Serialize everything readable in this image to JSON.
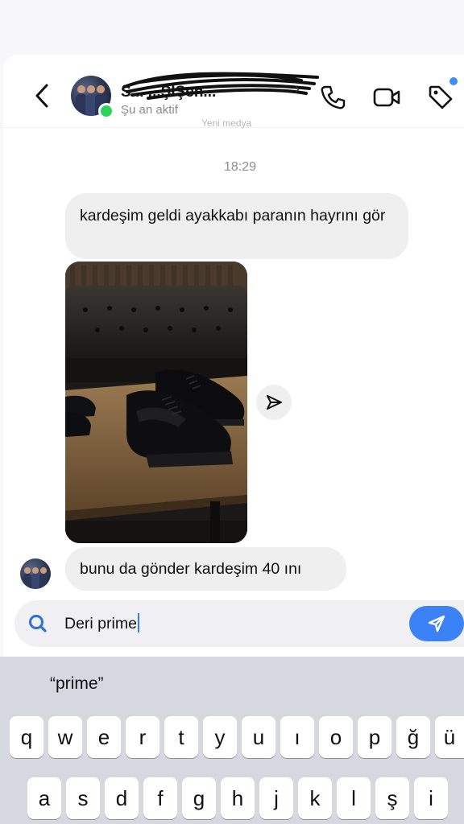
{
  "header": {
    "contact_name": "S... ...ŞİŞen...",
    "status": "Şu an aktif",
    "faded_text": "Yeni medya"
  },
  "messages": {
    "timestamp": "18:29",
    "message1": "kardeşim geldi ayakkabı paranın hayrını gör",
    "message2": "bunu da gönder kardeşim 40 ını"
  },
  "composer": {
    "value": "Deri prime"
  },
  "keyboard": {
    "suggestion": "“prime”",
    "row1": [
      "q",
      "w",
      "e",
      "r",
      "t",
      "y",
      "u",
      "ı",
      "o",
      "p",
      "ğ",
      "ü"
    ],
    "row2": [
      "a",
      "s",
      "d",
      "f",
      "g",
      "h",
      "j",
      "k",
      "l",
      "ş",
      "i"
    ]
  },
  "colors": {
    "accent": "#3b82f6",
    "online": "#2bd45b",
    "bubble": "#efefef"
  },
  "icons": [
    "back-icon",
    "phone-icon",
    "video-icon",
    "tag-icon",
    "share-icon",
    "search-icon",
    "send-icon"
  ]
}
